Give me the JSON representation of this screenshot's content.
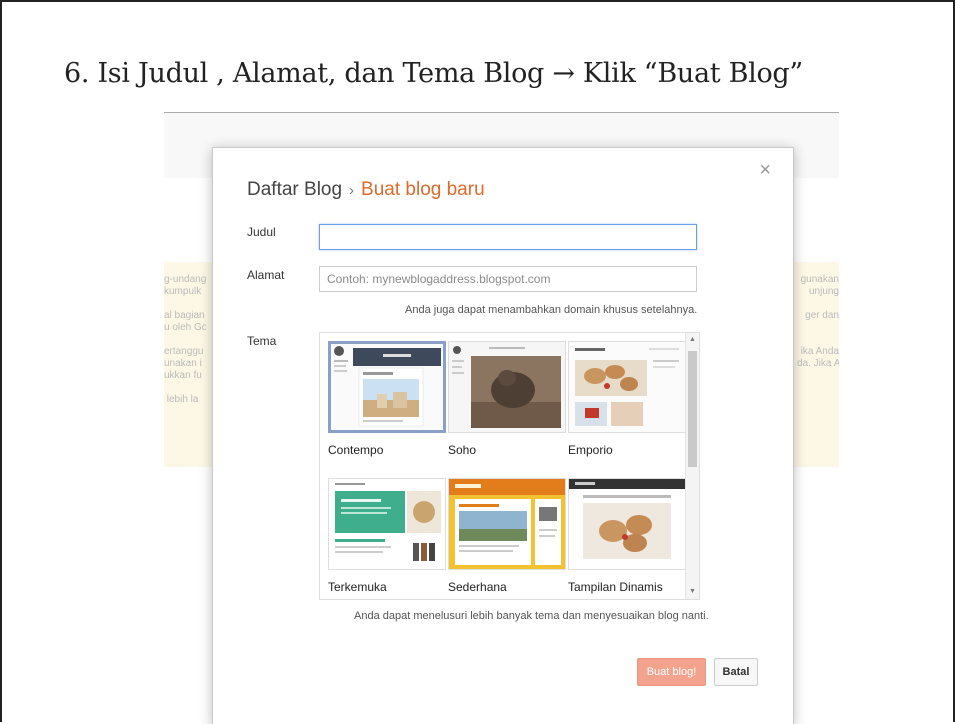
{
  "slide": {
    "title": "6. Isi Judul , Alamat, dan Tema Blog → Klik “Buat Blog”"
  },
  "background_text": {
    "left": "g-undang\nkumpulk\n\nal bagian\nu oleh Go\n\nertanggu\nunakan i\nukkan fu\n\n lebih la",
    "right": "gunakan\nunjung\n\nger dan\n\n\nika Anda\nda. Jika A"
  },
  "dialog": {
    "close_symbol": "×",
    "breadcrumb": {
      "parent": "Daftar Blog",
      "separator": "›",
      "current": "Buat blog baru"
    },
    "title_field": {
      "label": "Judul",
      "value": "",
      "placeholder": ""
    },
    "address_field": {
      "label": "Alamat",
      "value": "",
      "placeholder": "Contoh: mynewblogaddress.blogspot.com"
    },
    "address_hint": "Anda juga dapat menambahkan domain khusus setelahnya.",
    "theme_label": "Tema",
    "themes": [
      {
        "name": "Contempo",
        "selected": true
      },
      {
        "name": "Soho",
        "selected": false
      },
      {
        "name": "Emporio",
        "selected": false
      },
      {
        "name": "Terkemuka",
        "selected": false
      },
      {
        "name": "Sederhana",
        "selected": false
      },
      {
        "name": "Tampilan Dinamis",
        "selected": false
      }
    ],
    "theme_hint": "Anda dapat menelusuri lebih banyak tema dan menyesuaikan blog nanti.",
    "create_button": "Buat blog!",
    "cancel_button": "Batal"
  },
  "colors": {
    "accent": "#e06a2c",
    "create_button": "#f3a28d",
    "focus_border": "#6d9eea",
    "selected_theme_border": "#8aa0c8"
  }
}
